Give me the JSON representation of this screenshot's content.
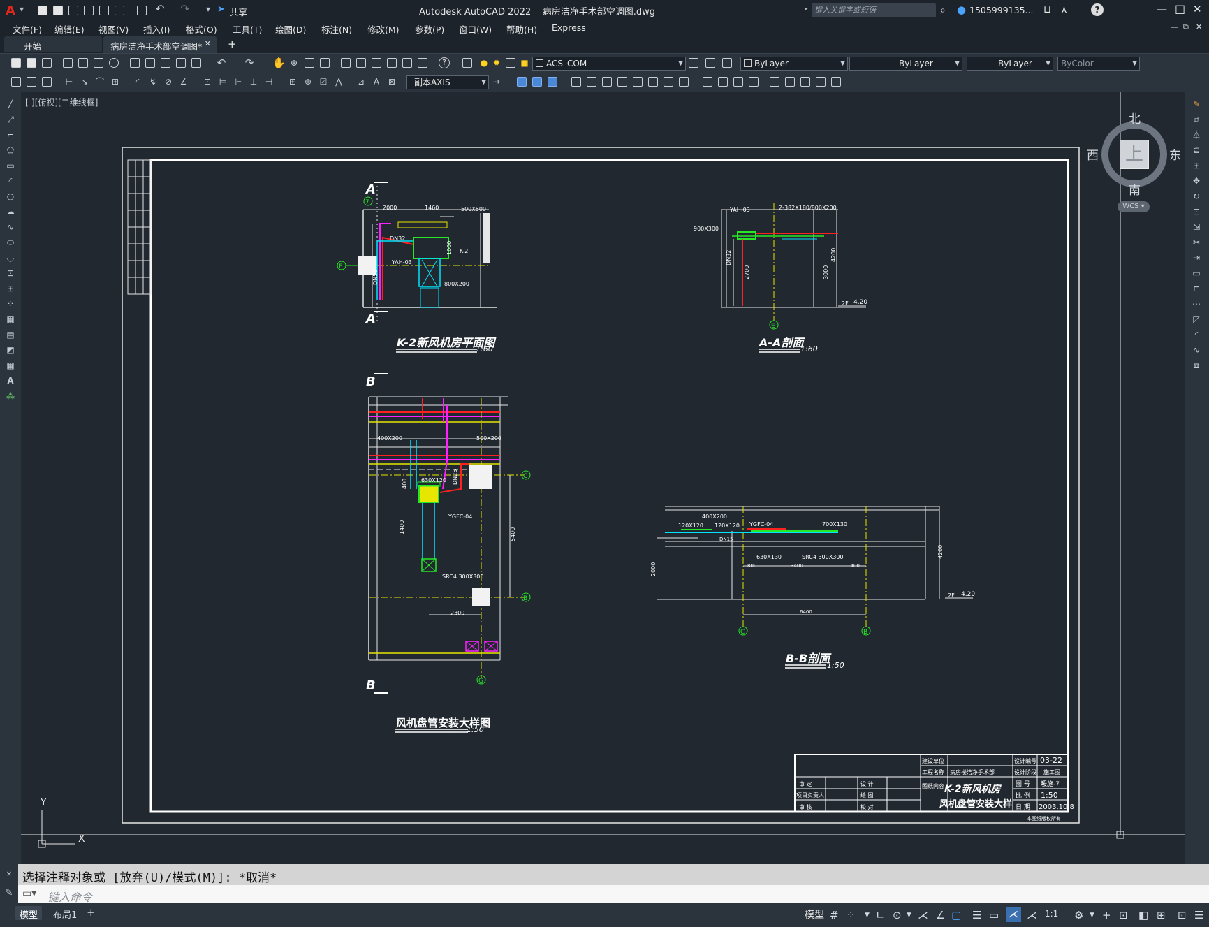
{
  "app": {
    "title": "Autodesk AutoCAD 2022",
    "filename": "病房洁净手术部空调图.dwg"
  },
  "titlebar": {
    "share": "共享",
    "search_placeholder": "键入关键字或短语",
    "user": "1505999135...",
    "min": "—",
    "max": "□",
    "close": "✕",
    "help": "?"
  },
  "menus": [
    "文件(F)",
    "编辑(E)",
    "视图(V)",
    "插入(I)",
    "格式(O)",
    "工具(T)",
    "绘图(D)",
    "标注(N)",
    "修改(M)",
    "参数(P)",
    "窗口(W)",
    "帮助(H)",
    "Express"
  ],
  "tabs": {
    "start": "开始",
    "doc": "病房洁净手术部空调图*",
    "close": "✕",
    "add": "+"
  },
  "toolbar": {
    "layer": "ACS_COM",
    "color": "ByLayer",
    "linetype": "ByLayer",
    "lineweight": "ByLayer",
    "plotstyle": "ByColor",
    "dimstyle": "副本AXIS"
  },
  "viewport": {
    "label": "[-][俯视][二维线框]",
    "wcs": "WCS",
    "compass": {
      "north": "北",
      "south": "南",
      "east": "东",
      "west": "西",
      "top": "上"
    },
    "ucs_x": "X",
    "ucs_y": "Y"
  },
  "drawing": {
    "plan_title": "K-2新风机房平面图",
    "plan_scale": "1:60",
    "aa_title": "A-A剖面",
    "aa_scale": "1:60",
    "detail_title": "风机盘管安装大样图",
    "detail_scale": "1:50",
    "bb_title": "B-B剖面",
    "bb_scale": "1:50",
    "marks": {
      "A": "A",
      "B": "B",
      "C": "C",
      "E": "E",
      "G": "G",
      "7": "7"
    },
    "plan_labels": {
      "d1": "2000",
      "d2": "1460",
      "dn32": "DN32",
      "yah": "YAH-03",
      "k2": "K-2",
      "duct": "500X500",
      "duct2": "800X200",
      "d3": "1000",
      "dn50": "DN50"
    },
    "aa_labels": {
      "duct": "2-382X180/800X200",
      "yah": "YAH-03",
      "d1": "900X300",
      "dn32": "DN32",
      "h1": "2700",
      "h2": "3000",
      "h3": "4200",
      "lvl": "4.20",
      "lvl2": "2F"
    },
    "detail_labels": {
      "d1": "400X200",
      "d2": "500X200",
      "fc": "630X120",
      "ygfc": "YGFC-04",
      "src": "SRC4 300X300",
      "h1": "1400",
      "h2": "5400",
      "w1": "2300",
      "dn": "DN25",
      "h3": "400"
    },
    "bb_labels": {
      "d1": "400X200",
      "d2": "120X120",
      "d3": "120X120",
      "ygfc": "YGFC-04",
      "d4": "700X130",
      "fc": "630X130",
      "src": "SRC4 300X300",
      "w1": "800",
      "w2": "3400",
      "w3": "1400",
      "total": "6400",
      "h1": "2000",
      "h2": "4200",
      "lvl": "4.20",
      "lvl2": "2F",
      "dn": "DN15"
    },
    "titleblock": {
      "owner_l": "建设单位",
      "project_l": "工程名称",
      "project": "病房楼洁净手术部",
      "drawing_l": "图纸内容",
      "drawing1": "K-2新风机房",
      "drawing2": "风机盘管安装大样",
      "no_l": "设计编号",
      "no": "03-22",
      "phase_l": "设计阶段",
      "phase": "施工图",
      "sheet_l": "图 号",
      "sheet": "暖施-7",
      "scale_l": "比 例",
      "scale": "1:50",
      "date_l": "日 期",
      "date": "2003.10.8",
      "shen": "审 定",
      "sheji": "设 计",
      "xmfz": "项目负责人",
      "huitu": "绘 图",
      "shenhe": "审 核",
      "jiaodui": "校 对",
      "company": "本图纸版权所有"
    }
  },
  "command": {
    "history": "选择注释对象或 [放弃(U)/模式(M)]: *取消*",
    "placeholder": "键入命令"
  },
  "layouts": {
    "model": "模型",
    "layout1": "布局1",
    "add": "+"
  },
  "status": {
    "model": "模型",
    "scale": "1:1"
  }
}
